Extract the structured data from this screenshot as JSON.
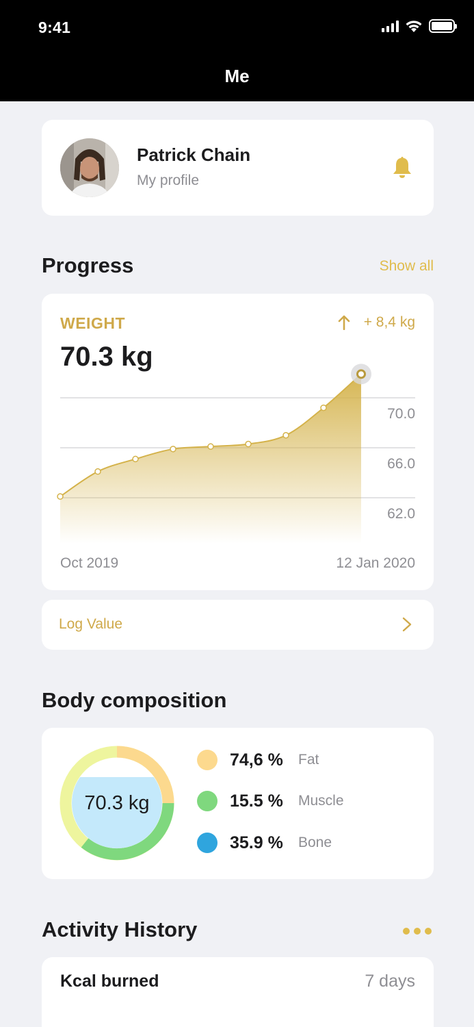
{
  "status_bar": {
    "time": "9:41"
  },
  "nav": {
    "title": "Me"
  },
  "profile": {
    "name": "Patrick Chain",
    "subtitle": "My profile",
    "avatar_icon": "person-photo",
    "bell_icon": "bell-icon"
  },
  "progress": {
    "title": "Progress",
    "show_all": "Show all"
  },
  "weight": {
    "label": "WEIGHT",
    "value": "70.3 kg",
    "change": "+ 8,4 kg",
    "change_icon": "arrow-up-icon"
  },
  "chart_data": {
    "type": "area",
    "title": "",
    "xlabel": "",
    "ylabel": "",
    "x_start_label": "Oct 2019",
    "x_end_label": "12 Jan 2020",
    "y_ticks": [
      70.0,
      66.0,
      62.0
    ],
    "y_tick_labels": [
      "70.0",
      "66.0",
      "62.0"
    ],
    "ylim": [
      62.0,
      70.0
    ],
    "values": [
      62.1,
      64.1,
      65.1,
      65.9,
      66.1,
      66.3,
      67.0,
      69.2,
      71.9
    ],
    "grid": true,
    "color": "#d4b24a"
  },
  "log": {
    "label": "Log Value"
  },
  "body_composition": {
    "title": "Body composition",
    "center_value": "70.3 kg",
    "items": [
      {
        "pct": "74,6 %",
        "name": "Fat",
        "color": "#fcd98e"
      },
      {
        "pct": "15.5 %",
        "name": "Muscle",
        "color": "#7fd87e"
      },
      {
        "pct": "35.9 %",
        "name": "Bone",
        "color": "#2fa5de"
      }
    ],
    "ring_color": "#eef59e",
    "center_fill": "#c4e9fb"
  },
  "activity": {
    "title": "Activity History",
    "card_title": "Kcal burned",
    "range": "7 days"
  },
  "colors": {
    "accent": "#e0bc4c",
    "accent_dark": "#cfa94a"
  }
}
